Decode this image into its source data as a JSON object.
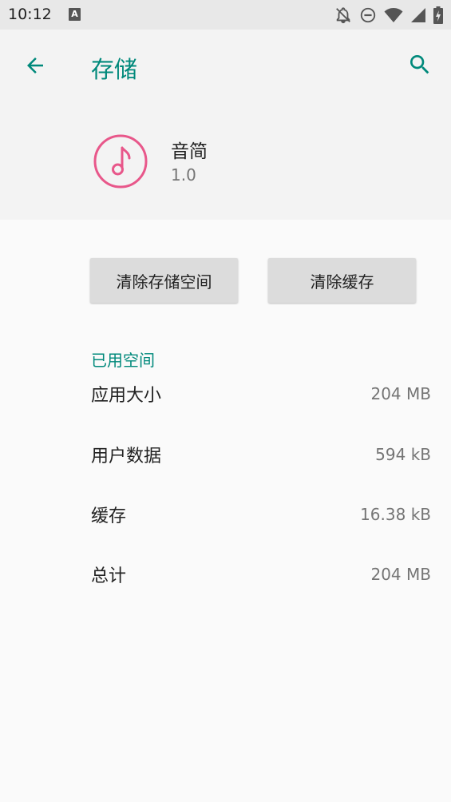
{
  "status_bar": {
    "time": "10:12",
    "notification_letter": "A",
    "icons": [
      "notifications-off-icon",
      "do-not-disturb-icon",
      "wifi-icon",
      "signal-icon",
      "battery-charging-icon"
    ]
  },
  "header": {
    "title": "存储",
    "back_icon": "arrow-back-icon",
    "search_icon": "search-icon"
  },
  "app": {
    "name": "音简",
    "version": "1.0",
    "icon": "music-note-icon",
    "icon_color": "#e8578a"
  },
  "buttons": {
    "clear_storage": "清除存储空间",
    "clear_cache": "清除缓存"
  },
  "usage": {
    "section_title": "已用空间",
    "rows": [
      {
        "label": "应用大小",
        "value": "204 MB"
      },
      {
        "label": "用户数据",
        "value": "594 kB"
      },
      {
        "label": "缓存",
        "value": "16.38 kB"
      },
      {
        "label": "总计",
        "value": "204 MB"
      }
    ]
  },
  "colors": {
    "accent": "#00897b",
    "header_bg": "#f3f3f3",
    "status_bar_bg": "#e8e8e8",
    "button_bg": "#dcdcdc"
  }
}
